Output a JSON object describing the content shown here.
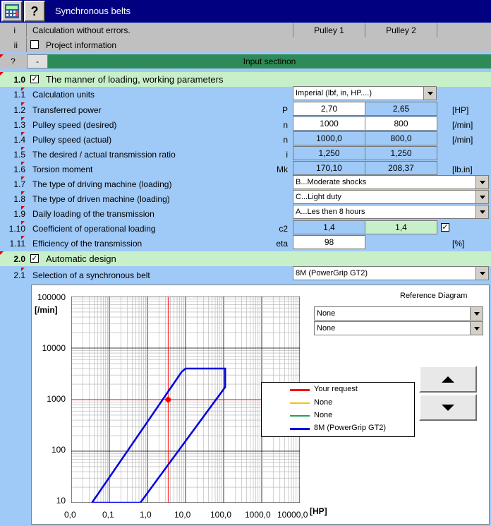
{
  "app": {
    "title": "Synchronous belts"
  },
  "toolbar": {
    "help_glyph": "?",
    "icon_name": "calculator-icon"
  },
  "header": {
    "row_id": "i",
    "status": "Calculation without errors.",
    "col1": "Pulley 1",
    "col2": "Pulley 2"
  },
  "project": {
    "row_id": "ii",
    "label": "Project information"
  },
  "input_section": {
    "q": "?",
    "minus": "-",
    "title": "Input sectinon"
  },
  "section1": {
    "id": "1.0",
    "title": "The manner of loading, working parameters"
  },
  "rows": {
    "r1": {
      "id": "1.1",
      "label": "Calculation units",
      "dropdown": "Imperial (lbf, in, HP....)"
    },
    "r2": {
      "id": "1.2",
      "label": "Transferred power",
      "sym": "P",
      "v1": "2,70",
      "v2": "2,65",
      "unit": "[HP]"
    },
    "r3": {
      "id": "1.3",
      "label": "Pulley speed (desired)",
      "sym": "n",
      "v1": "1000",
      "v2": "800",
      "unit": "[/min]"
    },
    "r4": {
      "id": "1.4",
      "label": "Pulley speed (actual)",
      "sym": "n",
      "v1": "1000,0",
      "v2": "800,0",
      "unit": "[/min]"
    },
    "r5": {
      "id": "1.5",
      "label": "The desired / actual transmission ratio",
      "sym": "i",
      "v1": "1,250",
      "v2": "1,250"
    },
    "r6": {
      "id": "1.6",
      "label": "Torsion moment",
      "sym": "Mk",
      "v1": "170,10",
      "v2": "208,37",
      "unit": "[lb.in]"
    },
    "r7": {
      "id": "1.7",
      "label": "The type of driving machine (loading)",
      "dropdown": "B...Moderate shocks"
    },
    "r8": {
      "id": "1.8",
      "label": "The type of driven machine (loading)",
      "dropdown": "C...Light duty"
    },
    "r9": {
      "id": "1.9",
      "label": "Daily loading of the transmission",
      "dropdown": "A...Les then 8 hours"
    },
    "r10": {
      "id": "1.10",
      "label": "Coefficient of operational loading",
      "sym": "c2",
      "v1": "1,4",
      "v2": "1,4"
    },
    "r11": {
      "id": "1.11",
      "label": "Efficiency of the transmission",
      "sym": "eta",
      "v1": "98",
      "unit": "[%]"
    }
  },
  "section2": {
    "id": "2.0",
    "title": "Automatic design"
  },
  "r21": {
    "id": "2.1",
    "label": "Selection of a synchronous belt",
    "dropdown": "8M (PowerGrip GT2)"
  },
  "reference": {
    "title": "Reference Diagram",
    "dd1": "None",
    "dd2": "None"
  },
  "colors": {
    "request": "#ff0000",
    "none1": "#ffc000",
    "none2": "#20a060",
    "belt": "#0000e0"
  },
  "chart_data": {
    "type": "line",
    "xscale": "log",
    "yscale": "log",
    "xlim": [
      0.01,
      10000
    ],
    "ylim": [
      10,
      100000
    ],
    "xlabel": "[HP]",
    "ylabel": "[/min]",
    "x_ticks": [
      "0,0",
      "0,1",
      "1,0",
      "10,0",
      "100,0",
      "1000,0",
      "10000,0"
    ],
    "y_ticks": [
      "100000",
      "10000",
      "1000",
      "100",
      "10"
    ],
    "legend_position": "right",
    "legend": [
      "Your request",
      "None",
      "None",
      "8M (PowerGrip GT2)"
    ],
    "series": [
      {
        "name": "8M (PowerGrip GT2)",
        "points": [
          [
            0.035,
            10
          ],
          [
            0.65,
            10
          ],
          [
            110,
            1750
          ],
          [
            110,
            4000
          ],
          [
            10,
            4000
          ],
          [
            8,
            3500
          ],
          [
            0.035,
            10
          ]
        ]
      },
      {
        "name": "Your request",
        "points": [
          [
            3.5,
            1000
          ]
        ]
      }
    ],
    "request_crosshair": {
      "x": 3.5,
      "y": 1000
    }
  }
}
